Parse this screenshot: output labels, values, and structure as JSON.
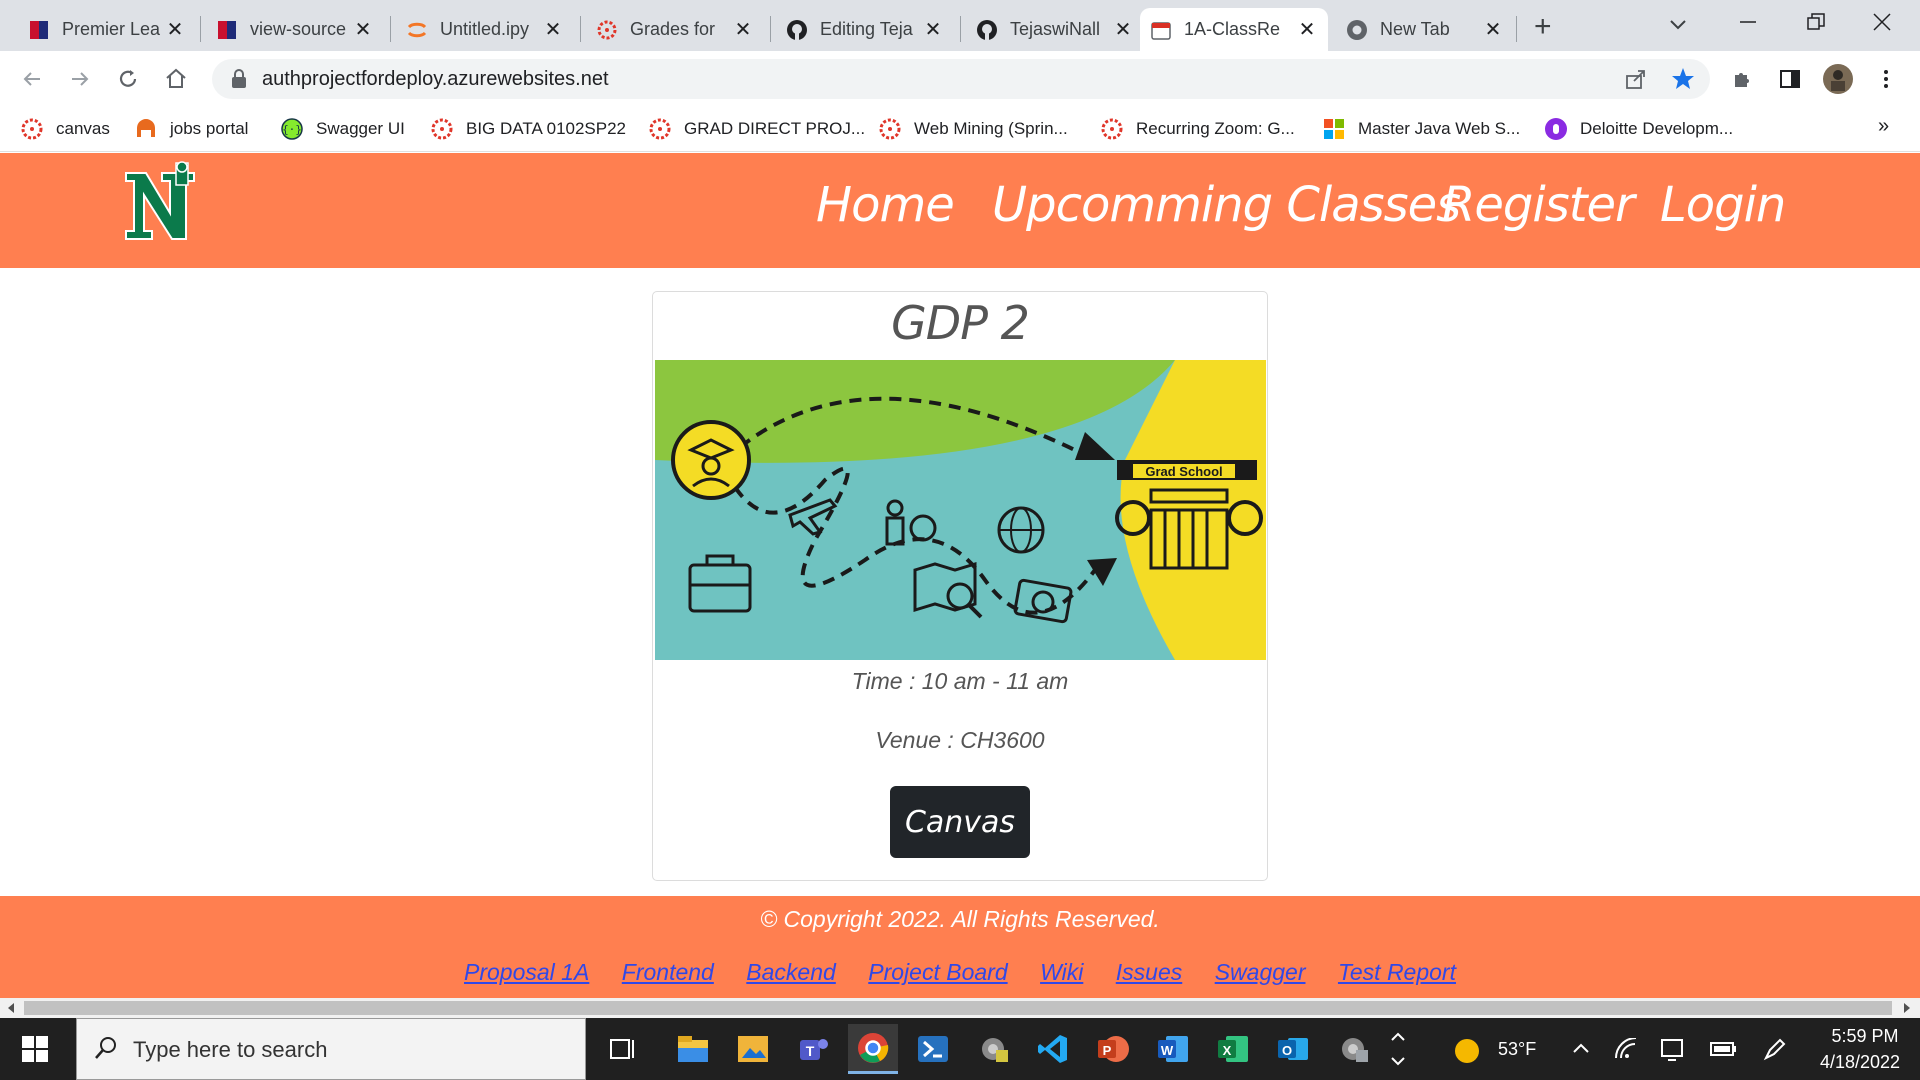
{
  "browser": {
    "tabs": [
      {
        "title": "Premier Lea",
        "icon": "premier-league-icon"
      },
      {
        "title": "view-source",
        "icon": "premier-league-icon"
      },
      {
        "title": "Untitled.ipy",
        "icon": "jupyter-icon"
      },
      {
        "title": "Grades for",
        "icon": "canvas-icon"
      },
      {
        "title": "Editing Teja",
        "icon": "github-icon"
      },
      {
        "title": "TejaswiNall",
        "icon": "github-icon"
      },
      {
        "title": "1A-ClassRe",
        "icon": "calendar-icon",
        "active": true
      },
      {
        "title": "New Tab",
        "icon": "chrome-icon"
      }
    ],
    "url": "authprojectfordeploy.azurewebsites.net",
    "bookmarks": [
      {
        "label": "canvas",
        "icon": "canvas-icon"
      },
      {
        "label": "jobs portal",
        "icon": "jobs-portal-icon"
      },
      {
        "label": "Swagger UI",
        "icon": "swagger-icon"
      },
      {
        "label": "BIG DATA 0102SP22",
        "icon": "canvas-icon"
      },
      {
        "label": "GRAD DIRECT PROJ...",
        "icon": "canvas-icon"
      },
      {
        "label": "Web Mining (Sprin...",
        "icon": "canvas-icon"
      },
      {
        "label": "Recurring Zoom: G...",
        "icon": "canvas-icon"
      },
      {
        "label": "Master Java Web S...",
        "icon": "microsoft-icon"
      },
      {
        "label": "Deloitte Developm...",
        "icon": "deloitte-icon"
      }
    ],
    "overflow": "»"
  },
  "site": {
    "logo": "N",
    "nav": [
      "Home",
      "Upcomming Classes",
      "Register",
      "Login"
    ],
    "card": {
      "title": "GDP 2",
      "image_caption": "Grad School",
      "time": "Time : 10 am - 11 am",
      "venue": "Venue : CH3600",
      "button": "Canvas"
    },
    "footer": {
      "copyright": "© Copyright 2022. All Rights Reserved.",
      "links": [
        "Proposal 1A",
        "Frontend",
        "Backend",
        "Project Board",
        "Wiki",
        "Issues",
        "Swagger",
        "Test Report"
      ]
    }
  },
  "taskbar": {
    "search_placeholder": "Type here to search",
    "weather": "53°F",
    "time": "5:59 PM",
    "date": "4/18/2022"
  },
  "colors": {
    "navbar": "#ff7f50",
    "button": "#212529",
    "link": "#3048e8",
    "logo_green": "#0b7a4b"
  }
}
